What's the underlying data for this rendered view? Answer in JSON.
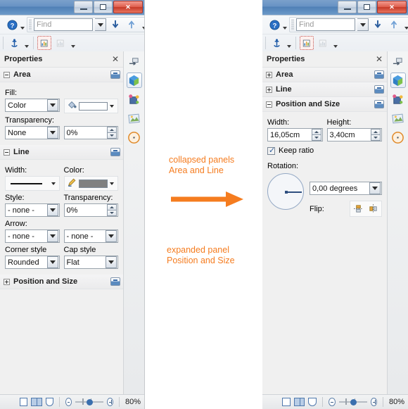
{
  "windows": {
    "left": {
      "title_buttons": {
        "minimize": "minimize-icon",
        "restore": "restore-icon",
        "close": "✕"
      },
      "toolbar": {
        "help_icon": "help-icon",
        "find_placeholder": "Find",
        "find_value": "",
        "find_down": "find-next-icon",
        "find_up": "find-previous-icon",
        "anchor_icon": "anchor-icon",
        "frame_icon_1": "chart-frame-icon",
        "frame_icon_2": "chart-frame-disabled-icon"
      },
      "sidebar": {
        "deck_title": "Properties",
        "close_label": "✕",
        "menu_icon": "sidebar-settings-icon",
        "tabs": [
          {
            "name": "properties-tab",
            "icon": "cube-icon",
            "selected": true
          },
          {
            "name": "gallery-tab",
            "icon": "gallery-icon",
            "selected": false
          },
          {
            "name": "navigator-tab",
            "icon": "navigator-icon",
            "selected": false
          },
          {
            "name": "styles-tab",
            "icon": "compass-icon",
            "selected": false
          }
        ],
        "panels": [
          {
            "name": "area-panel",
            "title": "Area",
            "expanded": true,
            "fields": {
              "fill_label": "Fill:",
              "fill_type": "Color",
              "fill_color_value": "#ffffff",
              "fill_color_icon": "paint-bucket-icon",
              "transparency_label": "Transparency:",
              "transparency_type": "None",
              "transparency_value": "0%"
            }
          },
          {
            "name": "line-panel",
            "title": "Line",
            "expanded": true,
            "fields": {
              "width_label": "Width:",
              "width_value": "line-width-sample",
              "color_label": "Color:",
              "color_value": "#808080",
              "color_icon": "pencil-icon",
              "style_label": "Style:",
              "style_value": "- none -",
              "transparency_label": "Transparency:",
              "transparency_value": "0%",
              "arrow_label": "Arrow:",
              "arrow_start": "- none -",
              "arrow_end": "- none -",
              "corner_style_label": "Corner style",
              "corner_style_value": "Rounded",
              "cap_style_label": "Cap style",
              "cap_style_value": "Flat"
            }
          },
          {
            "name": "position-size-panel",
            "title": "Position and Size",
            "expanded": false
          }
        ]
      },
      "statusbar": {
        "view_single": "single-page-view-icon",
        "view_multi": "multi-page-view-icon",
        "view_book": "book-view-icon",
        "zoom_out": "zoom-out-icon",
        "zoom_in": "zoom-in-icon",
        "zoom_percent": "80%"
      }
    },
    "right": {
      "title_buttons": {
        "minimize": "minimize-icon",
        "restore": "restore-icon",
        "close": "✕"
      },
      "toolbar": {
        "help_icon": "help-icon",
        "find_placeholder": "Find",
        "find_value": "",
        "find_down": "find-next-icon",
        "find_up": "find-previous-icon",
        "anchor_icon": "anchor-icon",
        "frame_icon_1": "chart-frame-icon",
        "frame_icon_2": "chart-frame-disabled-icon"
      },
      "sidebar": {
        "deck_title": "Properties",
        "close_label": "✕",
        "menu_icon": "sidebar-settings-icon",
        "tabs": [
          {
            "name": "properties-tab",
            "icon": "cube-icon",
            "selected": true
          },
          {
            "name": "gallery-tab",
            "icon": "gallery-icon",
            "selected": false
          },
          {
            "name": "navigator-tab",
            "icon": "navigator-icon",
            "selected": false
          },
          {
            "name": "styles-tab",
            "icon": "compass-icon",
            "selected": false
          }
        ],
        "panels": [
          {
            "name": "area-panel",
            "title": "Area",
            "expanded": false
          },
          {
            "name": "line-panel",
            "title": "Line",
            "expanded": false
          },
          {
            "name": "position-size-panel",
            "title": "Position and Size",
            "expanded": true,
            "fields": {
              "width_label": "Width:",
              "width_value": "16,05cm",
              "height_label": "Height:",
              "height_value": "3,40cm",
              "keep_ratio_label": "Keep ratio",
              "keep_ratio_checked": true,
              "rotation_label": "Rotation:",
              "rotation_value": "0,00 degrees",
              "rotation_dial": "rotation-dial",
              "flip_label": "Flip:",
              "flip_vertical_icon": "flip-vertical-icon",
              "flip_horizontal_icon": "flip-horizontal-icon"
            }
          }
        ]
      },
      "statusbar": {
        "view_single": "single-page-view-icon",
        "view_multi": "multi-page-view-icon",
        "view_book": "book-view-icon",
        "zoom_out": "zoom-out-icon",
        "zoom_in": "zoom-in-icon",
        "zoom_percent": "80%"
      }
    }
  },
  "annotations": {
    "accent_color": "#F57C1F",
    "top_text": "collapsed panels\nArea and Line",
    "bottom_text": "expanded panel\nPosition and Size",
    "arrow": "right-arrow"
  }
}
